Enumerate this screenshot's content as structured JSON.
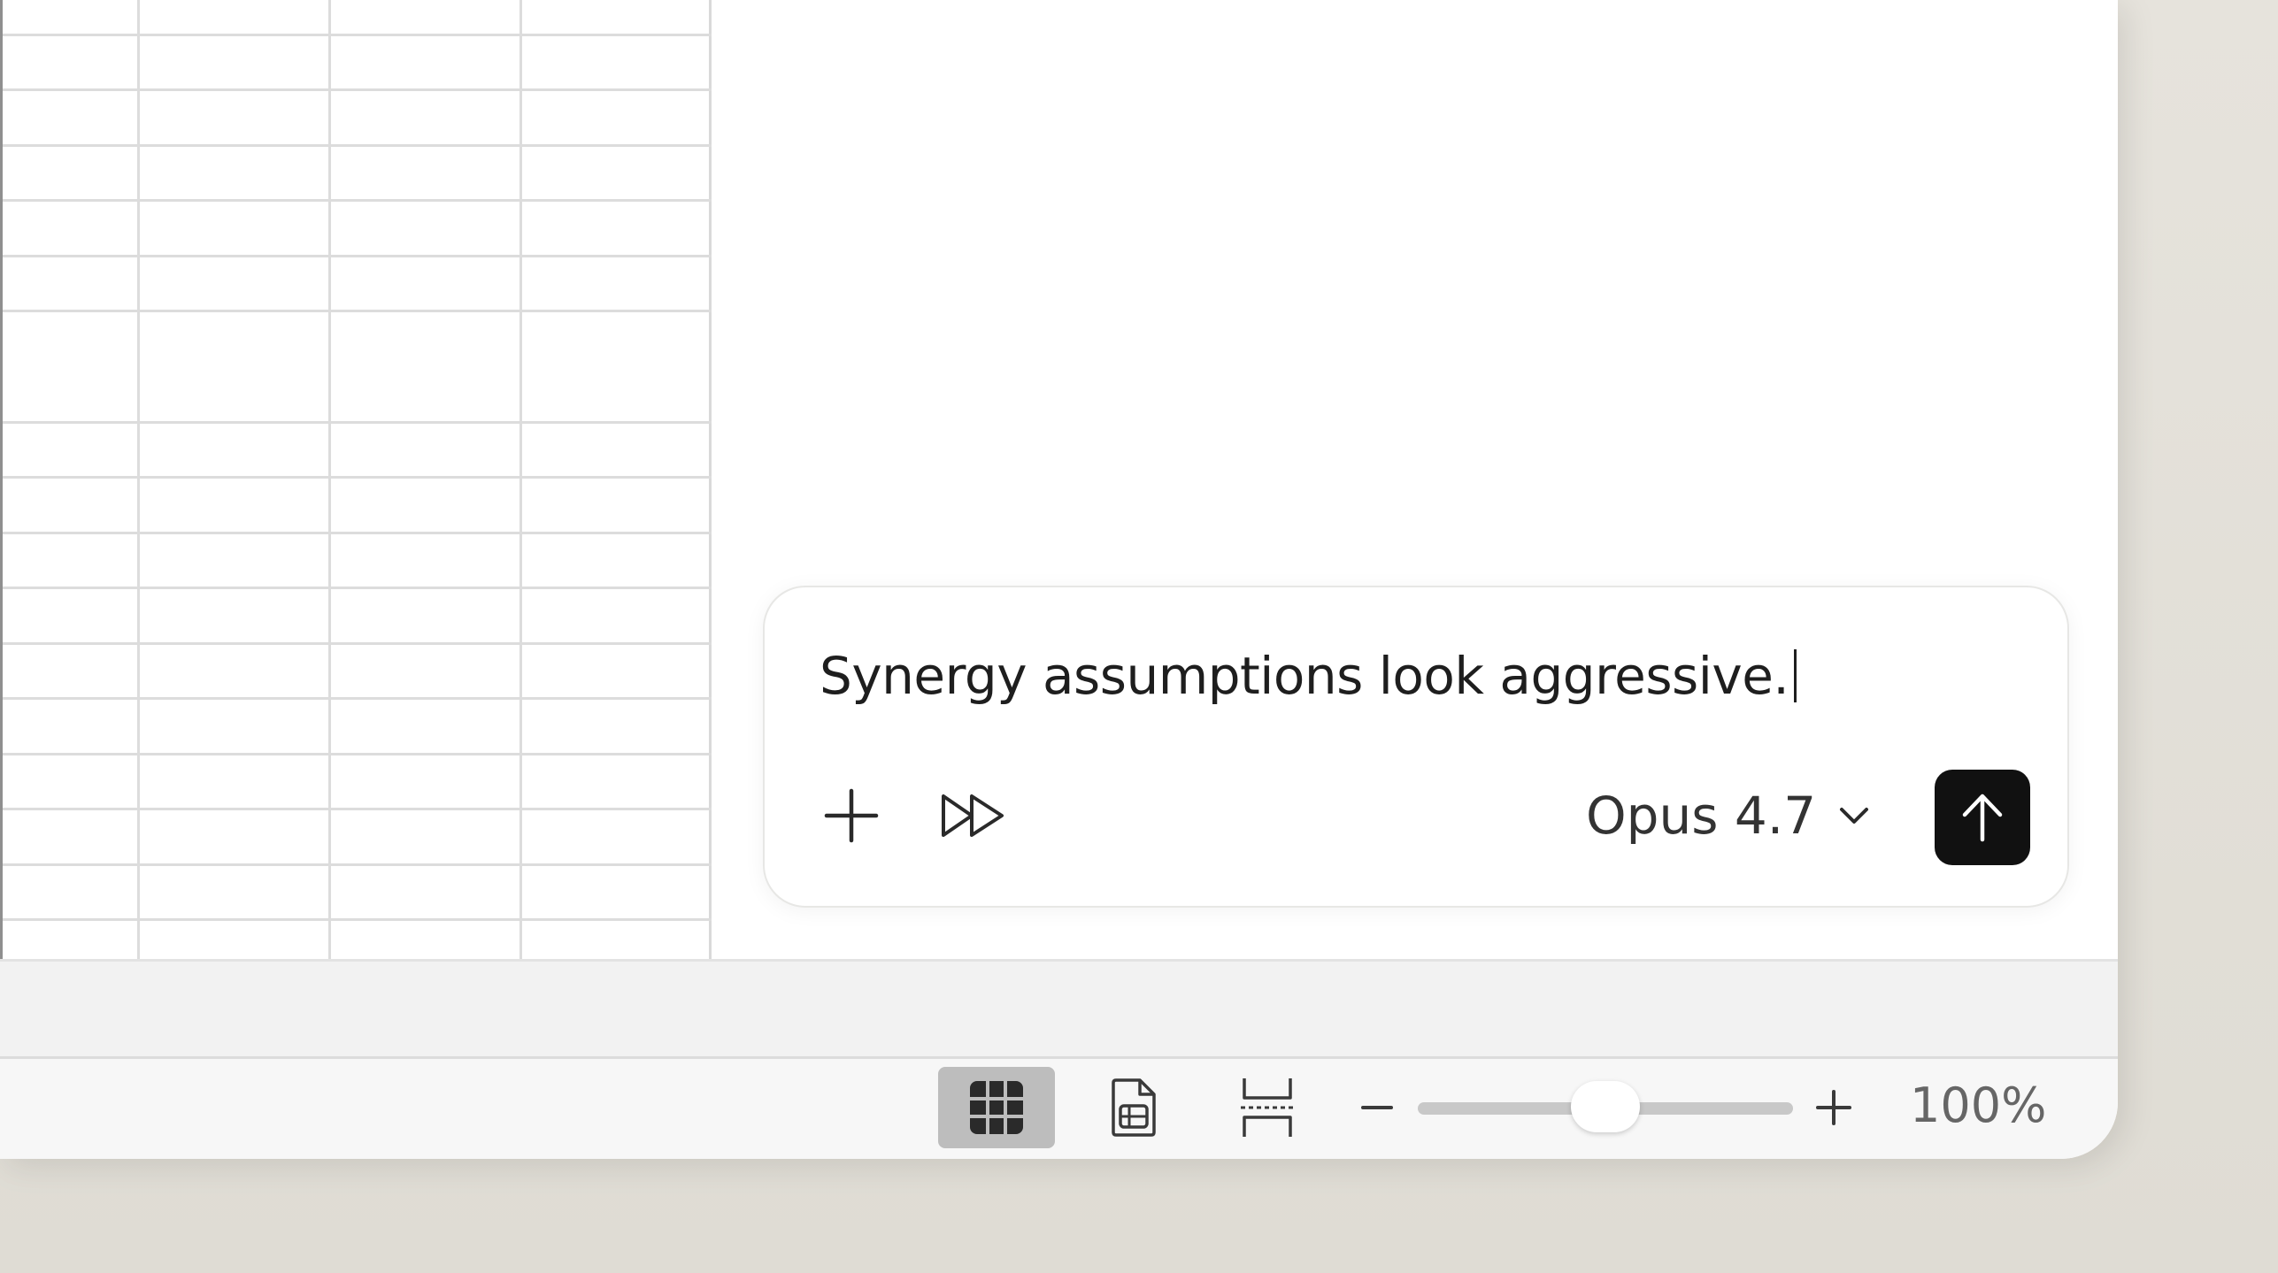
{
  "composer": {
    "input_value": "Synergy assumptions look aggressive.",
    "add_icon": "plus-icon",
    "fast_forward_icon": "fast-forward-icon",
    "model_label": "Opus 4.7",
    "model_icon": "chevron-down-icon",
    "send_icon": "arrow-up-icon"
  },
  "status_bar": {
    "views": [
      {
        "icon": "grid-view-icon",
        "selected": true
      },
      {
        "icon": "page-layout-icon",
        "selected": false
      },
      {
        "icon": "page-break-icon",
        "selected": false
      }
    ],
    "zoom_level": "100%",
    "zoom_fraction": 0.5
  },
  "colors": {
    "send_button": "#111111",
    "selected_view_bg": "#bdbdbd",
    "grid_line": "#dcdcdc",
    "background": "#e3e0d9"
  }
}
